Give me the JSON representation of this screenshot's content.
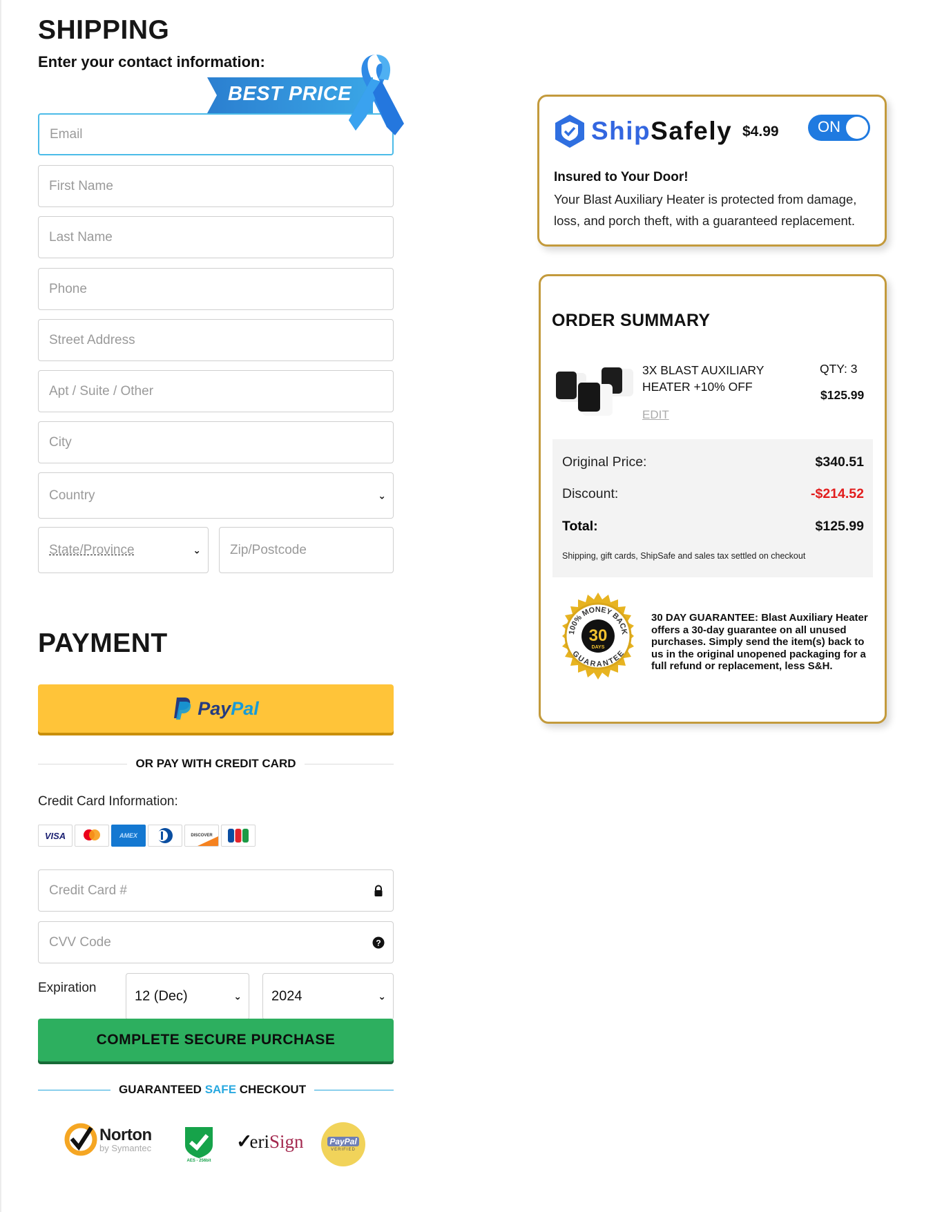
{
  "shipping": {
    "title": "SHIPPING",
    "subtitle": "Enter your contact information:",
    "banner": "BEST PRICE",
    "fields": {
      "email": {
        "placeholder": "Email",
        "value": ""
      },
      "first_name": {
        "placeholder": "First Name",
        "value": ""
      },
      "last_name": {
        "placeholder": "Last Name",
        "value": ""
      },
      "phone": {
        "placeholder": "Phone",
        "value": ""
      },
      "street": {
        "placeholder": "Street Address",
        "value": ""
      },
      "apt": {
        "placeholder": "Apt / Suite / Other",
        "value": ""
      },
      "city": {
        "placeholder": "City",
        "value": ""
      },
      "country": {
        "placeholder": "Country",
        "value": ""
      },
      "state": {
        "placeholder": "State/Province",
        "value": ""
      },
      "zip": {
        "placeholder": "Zip/Postcode",
        "value": ""
      }
    }
  },
  "payment": {
    "title": "PAYMENT",
    "paypal": {
      "pay": "Pay",
      "pal": "Pal"
    },
    "divider": "OR PAY WITH CREDIT CARD",
    "cc_label": "Credit Card Information:",
    "card_brands": [
      "VISA",
      "Mastercard",
      "AMEX",
      "Diners Club",
      "DISCOVER",
      "JCB"
    ],
    "card_number": {
      "placeholder": "Credit Card #",
      "value": ""
    },
    "cvv": {
      "placeholder": "CVV Code",
      "value": ""
    },
    "expiration_label": "Expiration",
    "exp_month": "12 (Dec)",
    "exp_year": "2024",
    "submit": "COMPLETE SECURE PURCHASE",
    "guarantee_pre": "GUARANTEED",
    "guarantee_safe": "SAFE",
    "guarantee_post": "CHECKOUT",
    "trust_badges": {
      "norton": "Norton",
      "norton_sub": "by Symantec",
      "aes": "AES - 256bit",
      "verisign": "VeriSign",
      "paypal_verified": "PayPal",
      "paypal_verified_sub": "VERIFIED"
    }
  },
  "shipsafe": {
    "ship": "Ship",
    "safely": "Safely",
    "price": "$4.99",
    "toggle_label": "ON",
    "toggle_on": true,
    "heading": "Insured to Your Door!",
    "body": "Your Blast Auxiliary Heater is protected from damage, loss, and porch theft, with a guaranteed replacement."
  },
  "order_summary": {
    "title": "ORDER SUMMARY",
    "item": {
      "name": "3X BLAST AUXILIARY HEATER +10% OFF",
      "qty": "QTY: 3",
      "price": "$125.99",
      "edit": "EDIT"
    },
    "original_label": "Original Price:",
    "original_value": "$340.51",
    "discount_label": "Discount:",
    "discount_value": "-$214.52",
    "total_label": "Total:",
    "total_value": "$125.99",
    "fine_print": "Shipping, gift cards, ShipSafe and sales tax settled on checkout",
    "seal": {
      "top": "100% MONEY BACK",
      "days": "30",
      "days_label": "DAYS",
      "bottom": "GUARANTEE"
    },
    "guarantee_text": "30 DAY GUARANTEE: Blast Auxiliary Heater offers a 30-day guarantee on all unused purchases. Simply send the item(s) back to us in the original unopened packaging for a full refund or replacement, less S&H."
  },
  "colors": {
    "accent_blue": "#1f7ae0",
    "gold": "#c39a3c",
    "paypal_yellow": "#ffc439",
    "buy_green": "#2daf5f",
    "discount_red": "#e21d1d",
    "safe_blue": "#29a9e0"
  }
}
